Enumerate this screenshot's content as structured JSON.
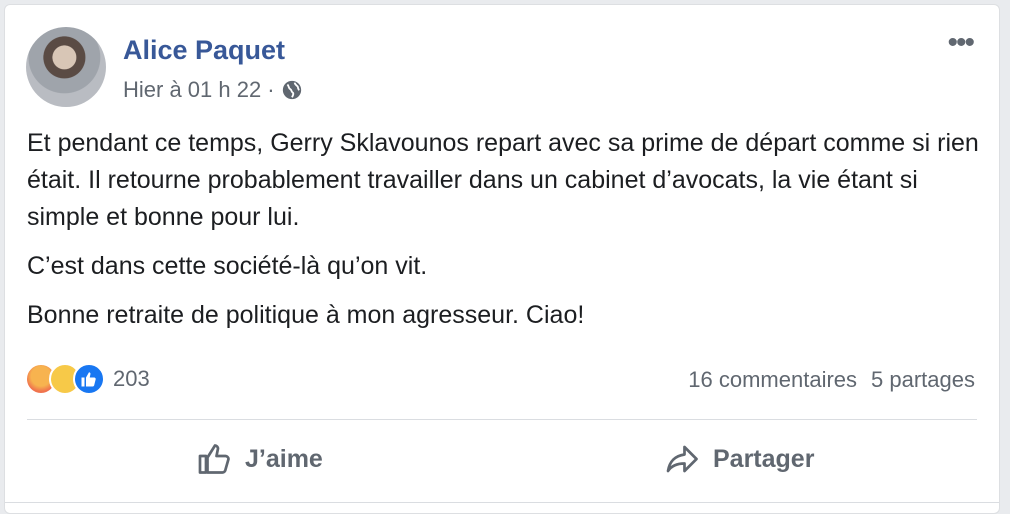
{
  "post": {
    "author": "Alice Paquet",
    "timestamp": "Hier à 01 h 22",
    "separator": "·",
    "visibility_icon": "globe-icon",
    "more_icon": "more-options-icon",
    "paragraphs": [
      "Et pendant ce temps, Gerry Sklavounos repart avec sa prime de départ comme si rien était. Il retourne probablement travailler dans un cabinet d’avocats, la vie étant si simple et bonne pour lui.",
      "C’est dans cette société-là qu’on vit.",
      "Bonne retraite de politique à mon agresseur. Ciao!"
    ]
  },
  "reactions": {
    "types": [
      "angry",
      "sad",
      "like"
    ],
    "count": "203"
  },
  "stats": {
    "comments": "16 commentaires",
    "shares": "5 partages"
  },
  "actions": {
    "like_label": "J’aime",
    "share_label": "Partager"
  },
  "colors": {
    "author": "#385898",
    "secondary_text": "#606770",
    "like_blue": "#1877f2"
  }
}
